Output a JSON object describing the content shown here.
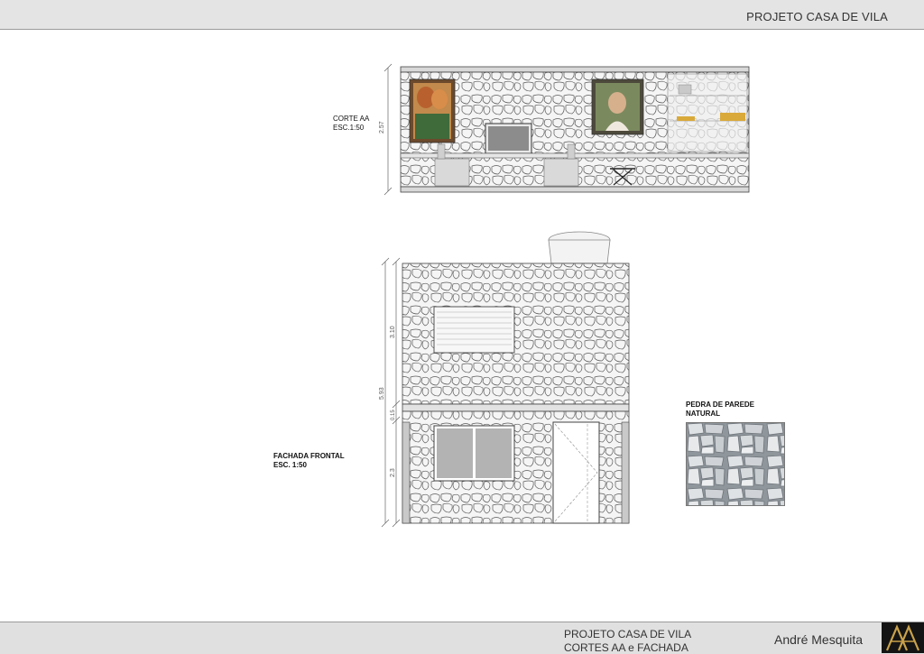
{
  "header": {
    "title": "PROJETO CASA DE VILA"
  },
  "corte": {
    "title": "CORTE AA",
    "scale": "ESC.1:50",
    "height_dim": "2.57"
  },
  "fachada": {
    "title": "FACHADA FRONTAL",
    "scale": "ESC. 1:50",
    "dims": {
      "total": "5.93",
      "upper": "3.10",
      "middle": "0.15",
      "lower": "2.3"
    }
  },
  "material": {
    "line1": "PEDRA DE PAREDE",
    "line2": "NATURAL"
  },
  "footer": {
    "project": "PROJETO CASA DE VILA",
    "sheet": "CORTES AA e FACHADA",
    "author": "André Mesquita"
  },
  "colors": {
    "wall_fill": "#f4f4f4",
    "stone_stroke": "#555555",
    "window_fill": "#b3b3b3",
    "bar_fill": "#e2e2e2"
  }
}
